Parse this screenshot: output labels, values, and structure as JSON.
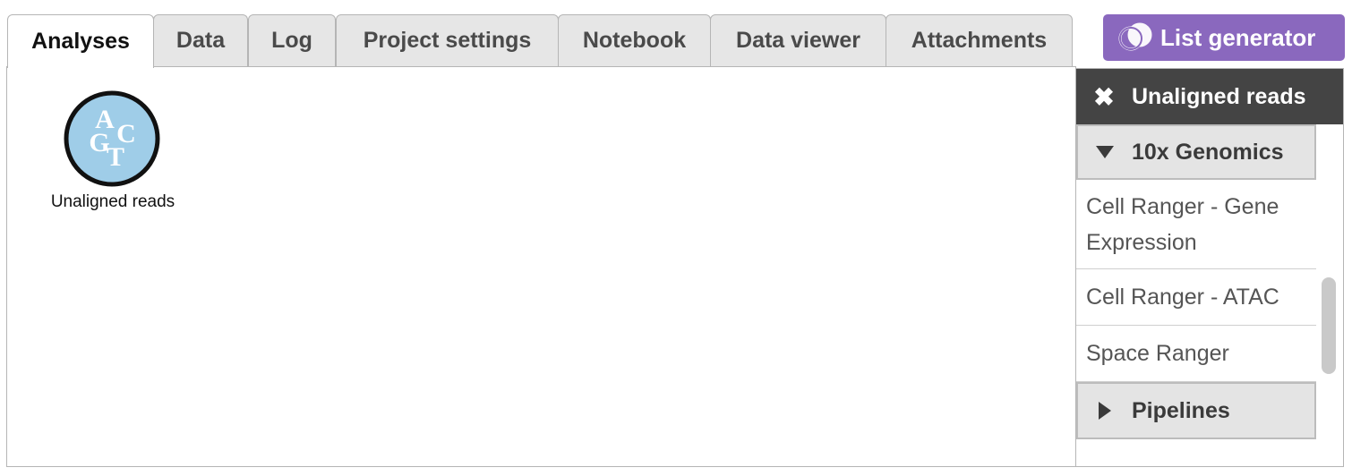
{
  "tabs": [
    {
      "label": "Analyses",
      "active": true
    },
    {
      "label": "Data"
    },
    {
      "label": "Log"
    },
    {
      "label": "Project settings"
    },
    {
      "label": "Notebook"
    },
    {
      "label": "Data viewer"
    },
    {
      "label": "Attachments"
    }
  ],
  "list_generator": {
    "label": "List generator",
    "color": "#8a68be"
  },
  "canvas": {
    "node": {
      "label": "Unaligned reads",
      "icon": "acgt-data-node-icon",
      "letters": [
        "A",
        "C",
        "G",
        "T"
      ],
      "fill": "#9fcde8"
    }
  },
  "sidebar": {
    "header": {
      "close": "✖",
      "title": "Unaligned reads"
    },
    "groups": [
      {
        "label": "10x Genomics",
        "expanded": true,
        "items": [
          "Cell Ranger - Gene Expression",
          "Cell Ranger - ATAC",
          "Space Ranger"
        ]
      },
      {
        "label": "Pipelines",
        "expanded": false
      }
    ]
  }
}
